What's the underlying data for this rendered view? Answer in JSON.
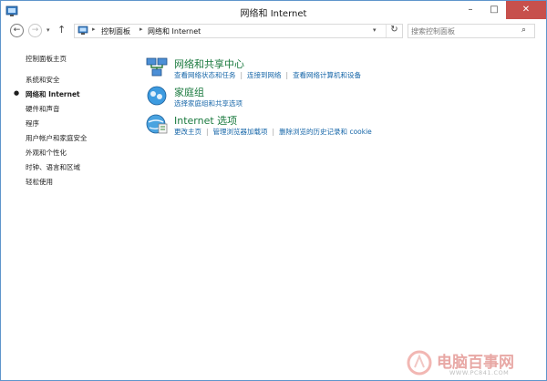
{
  "window": {
    "title": "网络和 Internet"
  },
  "titlebar": {
    "minimize": "–",
    "maximize": "□",
    "close": "✕"
  },
  "nav": {
    "back": "←",
    "forward": "→",
    "history": "▾",
    "up": "↑",
    "breadcrumbs": [
      "控制面板",
      "网络和 Internet"
    ],
    "separator": "▸",
    "dropdown": "▾",
    "refresh": "↻",
    "search_placeholder": "搜索控制面板",
    "search_icon": "⌕"
  },
  "sidebar": {
    "bullet": "●",
    "items": [
      {
        "label": "控制面板主页"
      },
      {
        "label": "系统和安全"
      },
      {
        "label": "网络和 Internet",
        "active": true
      },
      {
        "label": "硬件和声音"
      },
      {
        "label": "程序"
      },
      {
        "label": "用户帐户和家庭安全"
      },
      {
        "label": "外观和个性化"
      },
      {
        "label": "时钟、语言和区域"
      },
      {
        "label": "轻松使用"
      }
    ]
  },
  "categories": [
    {
      "title": "网络和共享中心",
      "icon": "network-icon",
      "links": [
        "查看网络状态和任务",
        "连接到网络",
        "查看网络计算机和设备"
      ]
    },
    {
      "title": "家庭组",
      "icon": "homegroup-icon",
      "links": [
        "选择家庭组和共享选项"
      ]
    },
    {
      "title": "Internet 选项",
      "icon": "internet-options-icon",
      "links": [
        "更改主页",
        "管理浏览器加载项",
        "删除浏览的历史记录和 cookie"
      ]
    }
  ],
  "watermark": {
    "text": "电脑百事网",
    "url": "WWW.PC841.COM"
  },
  "colors": {
    "accent_link": "#1666a8",
    "category_title": "#1b7a3f",
    "close_button": "#c7504c"
  }
}
